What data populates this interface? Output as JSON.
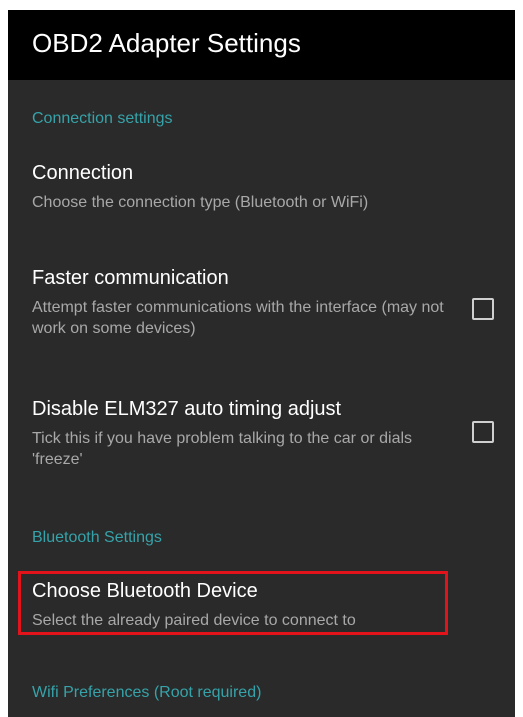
{
  "app_bar": {
    "title": "OBD2 Adapter Settings"
  },
  "sections": {
    "connection_header": "Connection settings",
    "bluetooth_header": "Bluetooth Settings",
    "wifi_header": "Wifi Preferences (Root required)"
  },
  "preferences": {
    "connection": {
      "title": "Connection",
      "summary": "Choose the connection type (Bluetooth or WiFi)"
    },
    "faster_communication": {
      "title": "Faster communication",
      "summary": "Attempt faster communications with the interface (may not work on some devices)",
      "checked": false
    },
    "disable_auto_timing": {
      "title": "Disable ELM327 auto timing adjust",
      "summary": "Tick this if you have problem talking to the car or dials 'freeze'",
      "checked": false
    },
    "choose_bluetooth_device": {
      "title": "Choose Bluetooth Device",
      "summary": "Select the already paired device to connect to"
    }
  },
  "colors": {
    "app_bar": "#000000",
    "background": "#2a2a2a",
    "accent": "#35a3a9",
    "highlight": "#e3131b"
  }
}
